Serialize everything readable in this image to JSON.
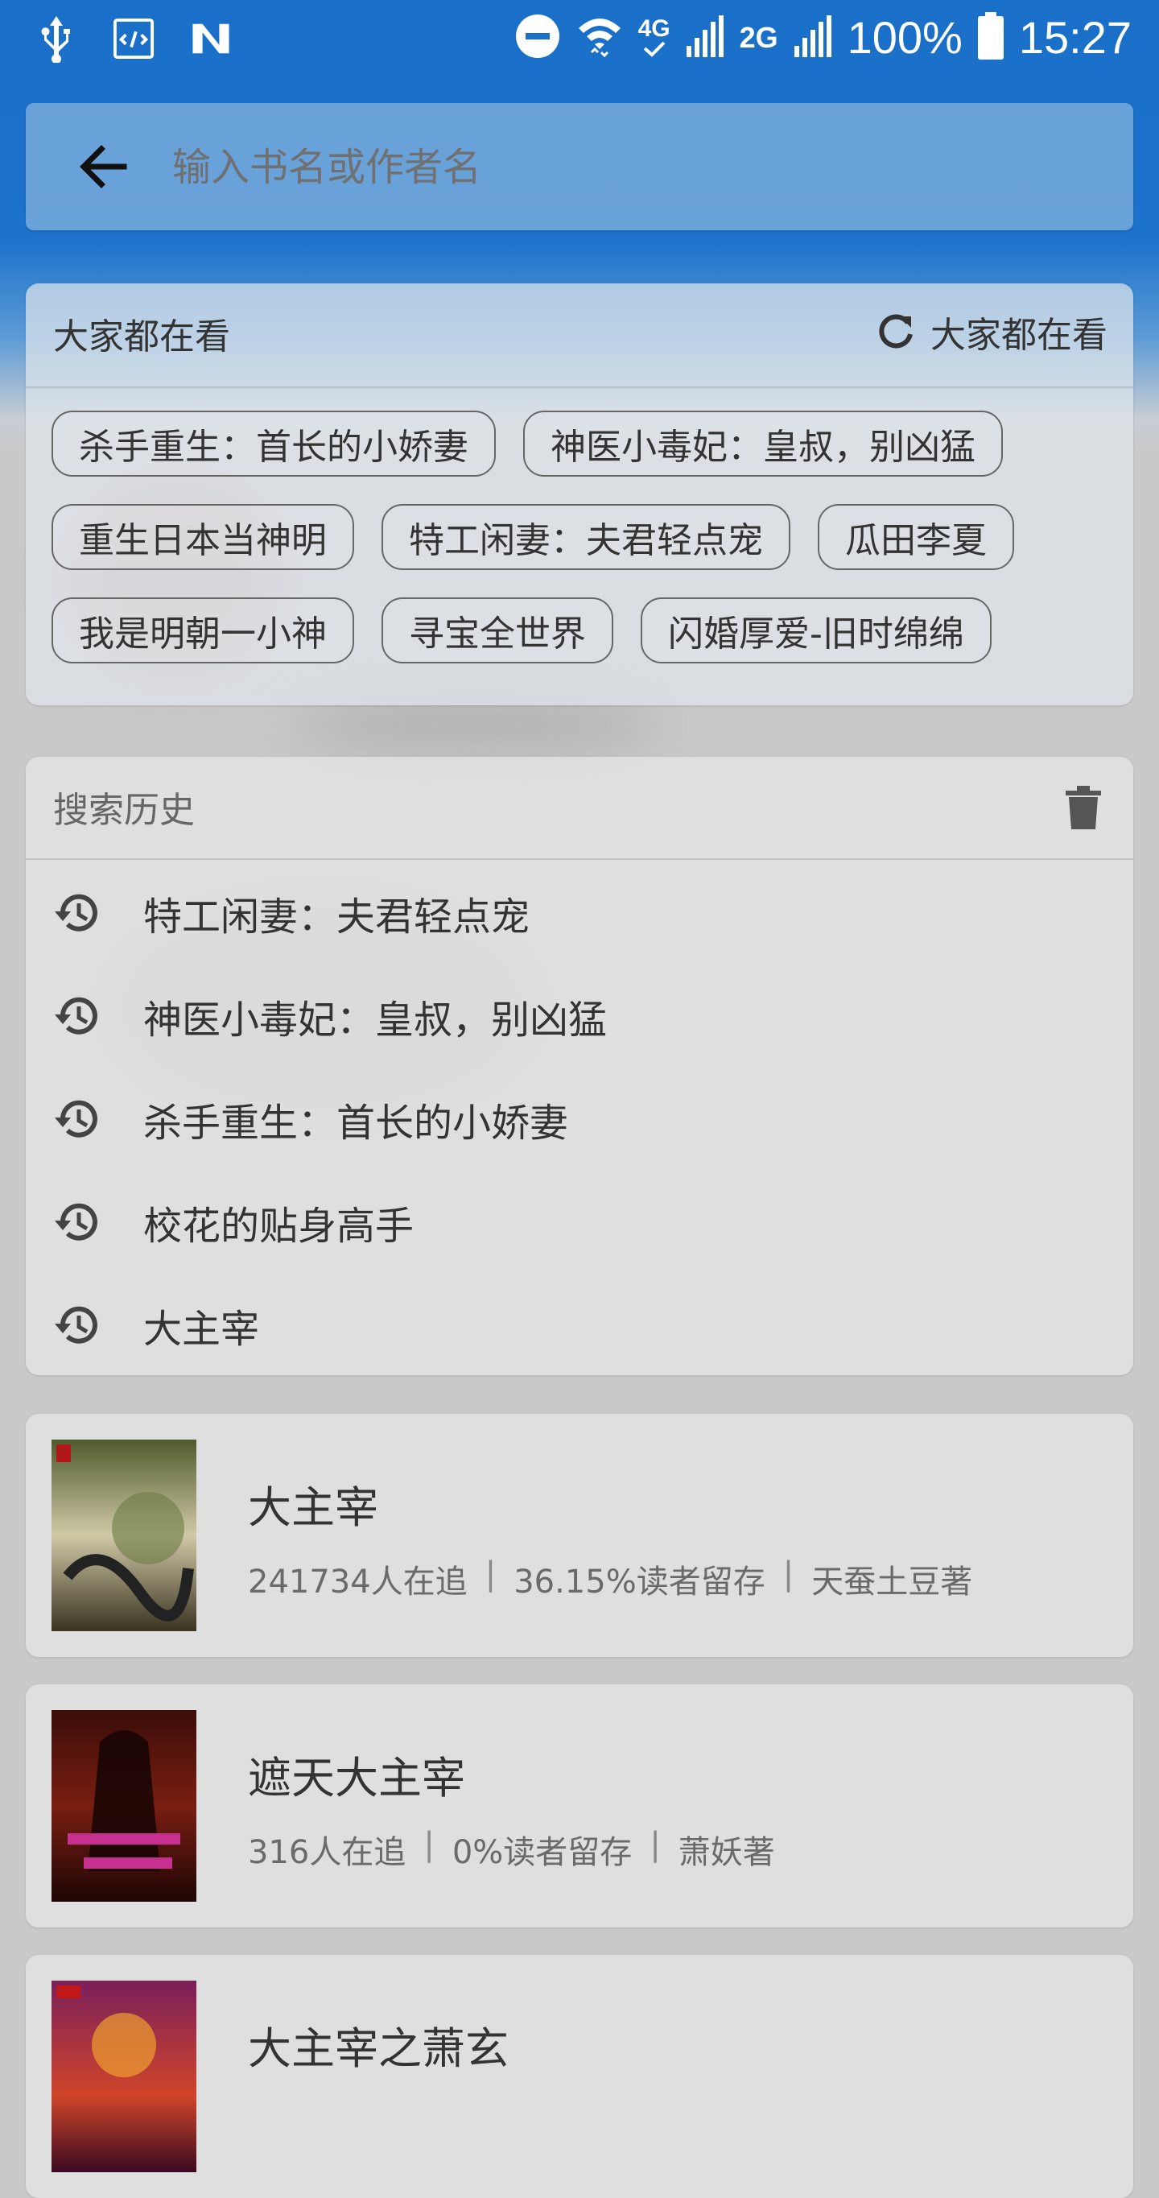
{
  "status_bar": {
    "network_4g": "4G",
    "network_2g": "2G",
    "battery": "100%",
    "time": "15:27"
  },
  "search": {
    "placeholder": "输入书名或作者名"
  },
  "hot": {
    "title": "大家都在看",
    "refresh_label": "大家都在看",
    "tags": [
      [
        "杀手重生：首长的小娇妻",
        "神医小毒妃：皇叔，别凶猛"
      ],
      [
        "重生日本当神明",
        "特工闲妻：夫君轻点宠",
        "瓜田李夏"
      ],
      [
        "我是明朝一小神",
        "寻宝全世界",
        "闪婚厚爱-旧时绵绵"
      ]
    ]
  },
  "history": {
    "title": "搜索历史",
    "items": [
      "特工闲妻：夫君轻点宠",
      "神医小毒妃：皇叔，别凶猛",
      "杀手重生：首长的小娇妻",
      "校花的贴身高手",
      "大主宰"
    ]
  },
  "results": [
    {
      "title": "大主宰",
      "followers": "241734人在追",
      "retention": "36.15%读者留存",
      "author": "天蚕土豆著"
    },
    {
      "title": "遮天大主宰",
      "followers": "316人在追",
      "retention": "0%读者留存",
      "author": "萧妖著"
    },
    {
      "title": "大主宰之萧玄",
      "followers": "",
      "retention": "",
      "author": ""
    }
  ],
  "colors": {
    "primary": "#1a6fc8",
    "text": "#333333",
    "secondary_text": "#6a6a6a"
  }
}
